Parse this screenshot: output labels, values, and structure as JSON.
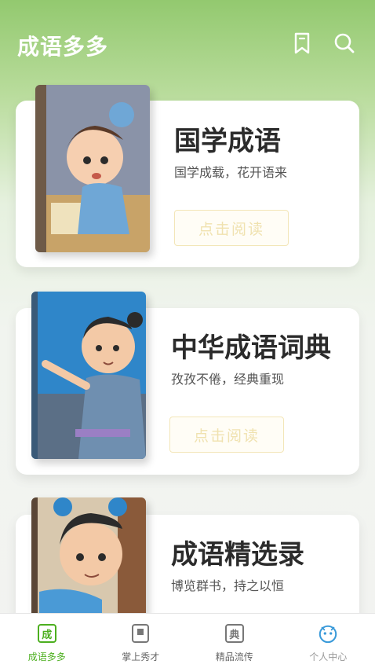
{
  "header": {
    "title": "成语多多",
    "bookmark_icon": "bookmark-icon",
    "search_icon": "search-icon"
  },
  "books": [
    {
      "title": "国学成语",
      "subtitle": "国学成载，花开语来",
      "button": "点击阅读"
    },
    {
      "title": "中华成语词典",
      "subtitle": "孜孜不倦，经典重现",
      "button": "点击阅读"
    },
    {
      "title": "成语精选录",
      "subtitle": "博览群书，持之以恒"
    }
  ],
  "tabs": [
    {
      "label": "成语多多",
      "glyph": "成",
      "active": true
    },
    {
      "label": "掌上秀才"
    },
    {
      "label": "精品流传",
      "glyph": "典"
    },
    {
      "label": "个人中心"
    }
  ],
  "colors": {
    "accent": "#4caf1f",
    "header_green": "#93c96f",
    "button_gold": "#f0e2b0"
  }
}
